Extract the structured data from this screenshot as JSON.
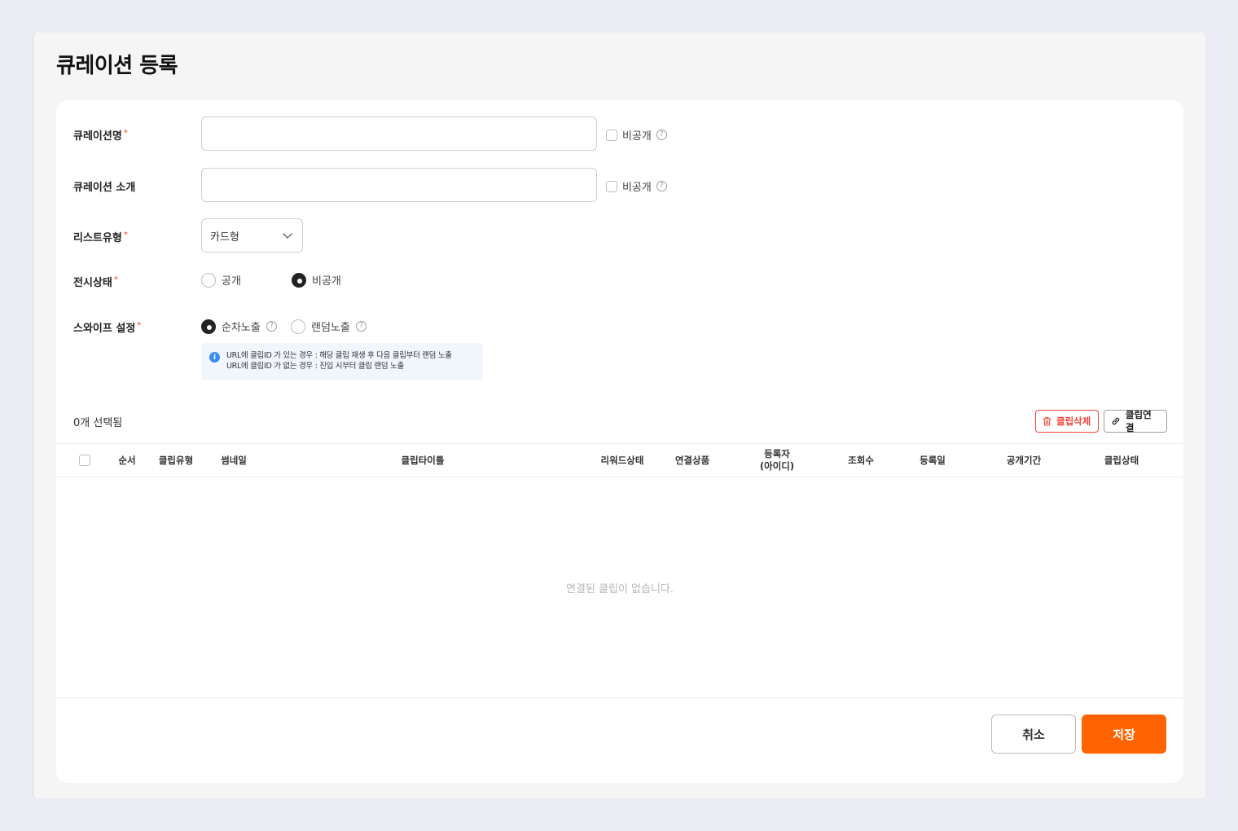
{
  "page": {
    "title": "큐레이션 등록"
  },
  "form": {
    "name": {
      "label": "큐레이션명",
      "required_mark": "*",
      "value": "",
      "private_label": "비공개"
    },
    "intro": {
      "label": "큐레이션 소개",
      "value": "",
      "private_label": "비공개"
    },
    "list_type": {
      "label": "리스트유형",
      "required_mark": "*",
      "selected": "카드형"
    },
    "display_status": {
      "label": "전시상태",
      "required_mark": "*",
      "options": [
        "공개",
        "비공개"
      ],
      "selected": "비공개"
    },
    "swipe": {
      "label": "스와이프 설정",
      "required_mark": "*",
      "options": [
        "순차노출",
        "랜덤노출"
      ],
      "selected": "순차노출",
      "info_lines": [
        "URL에 클립ID 가 있는 경우 : 해당 클립 재생 후 다음 클립부터 랜덤 노출",
        "URL에 클립ID 가 없는 경우 : 진입 시부터 클립 랜덤 노출"
      ]
    }
  },
  "clips": {
    "selected_count": "0개 선택됨",
    "delete_button": "클립삭제",
    "link_button": "클립연결",
    "columns": [
      "순서",
      "클립유형",
      "썸네일",
      "클립타이틀",
      "리워드상태",
      "연결상품",
      "등록자",
      "(아이디)",
      "조회수",
      "등록일",
      "공개기간",
      "클립상태"
    ],
    "empty_message": "연결된 클립이 없습니다."
  },
  "actions": {
    "cancel": "취소",
    "save": "저장"
  },
  "colors": {
    "accent": "#ff6400",
    "danger": "#f04438",
    "info": "#3a8bf0"
  },
  "icons": {
    "help": "question-circle-icon",
    "info": "info-circle-icon",
    "delete": "trash-icon",
    "link": "link-icon",
    "dropdown": "chevron-down-icon"
  }
}
